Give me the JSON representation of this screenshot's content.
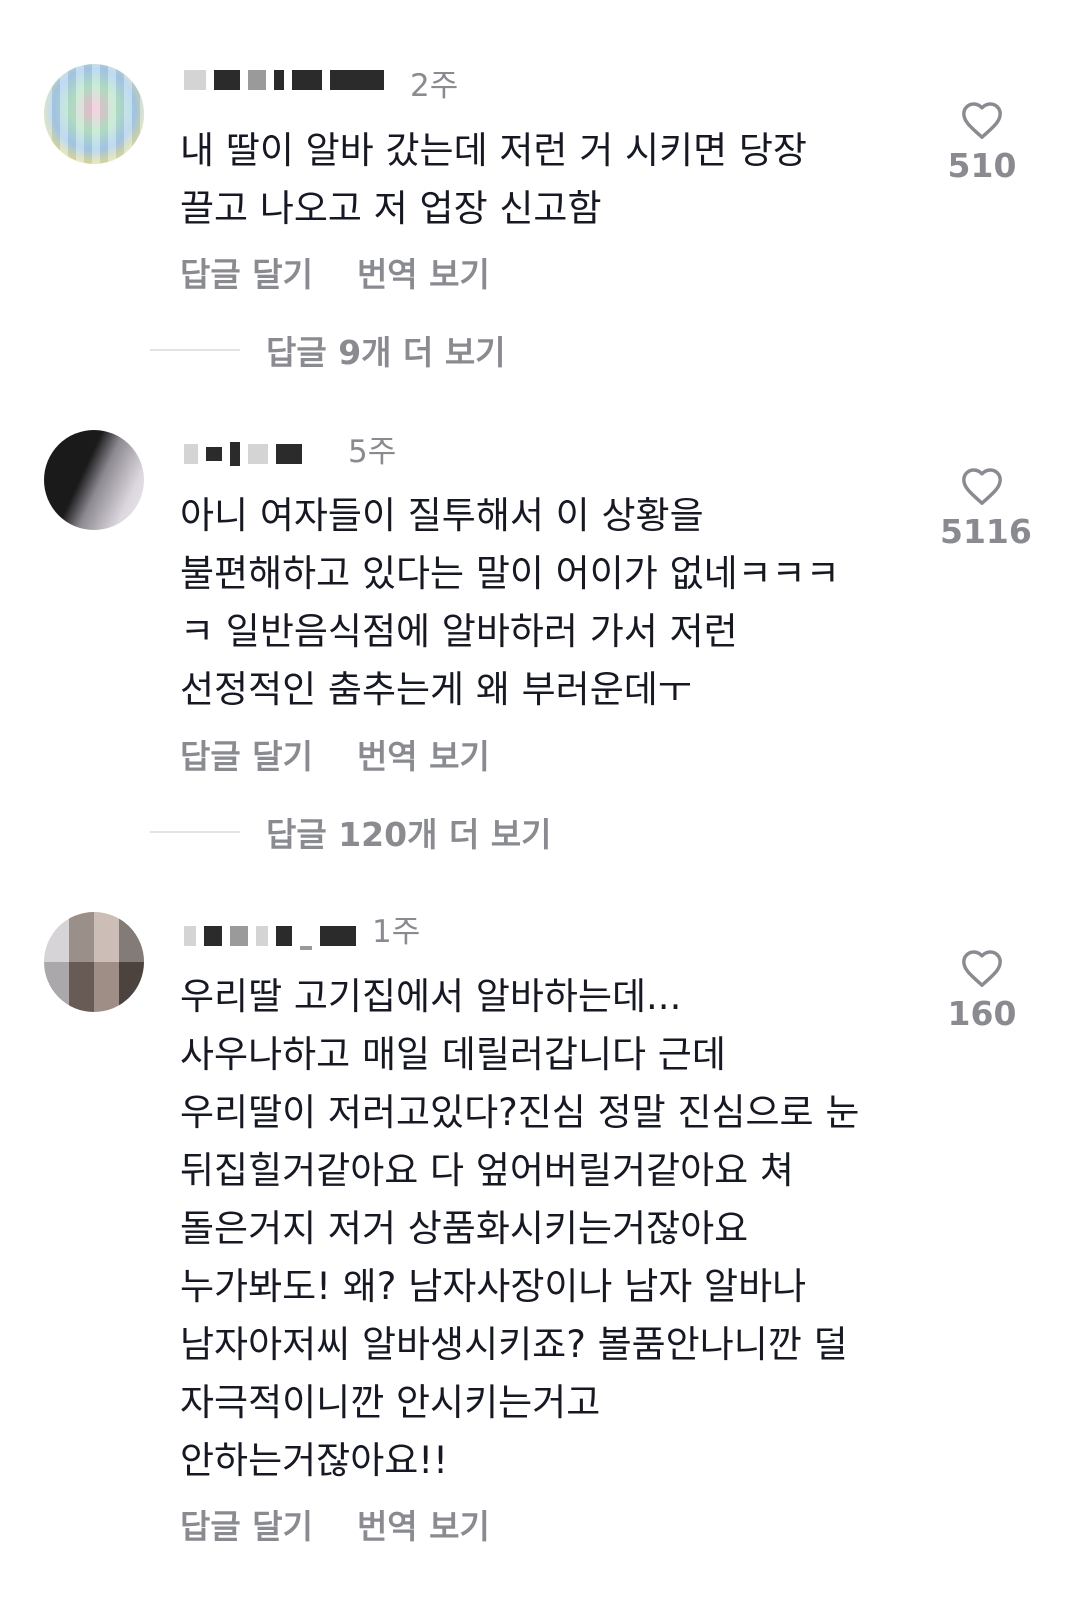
{
  "comments": [
    {
      "time": "2주",
      "lines": [
        "내 딸이 알바 갔는데 저런 거 시키면 당장",
        "끌고 나오고 저 업장 신고함"
      ],
      "reply_label": "답글 달기",
      "translate_label": "번역 보기",
      "likes": "510",
      "more_replies": "답글 9개 더 보기"
    },
    {
      "time": "5주",
      "lines": [
        "아니 여자들이 질투해서 이 상황을",
        "불편해하고 있다는 말이 어이가 없네ㅋㅋㅋ",
        "ㅋ 일반음식점에 알바하러 가서 저런",
        "선정적인 춤추는게 왜 부러운데ㅜ"
      ],
      "reply_label": "답글 달기",
      "translate_label": "번역 보기",
      "likes": "5116",
      "more_replies": "답글 120개 더 보기"
    },
    {
      "time": "1주",
      "lines": [
        "우리딸 고기집에서 알바하는데...",
        "사우나하고 매일 데릴러갑니다 근데",
        "우리딸이 저러고있다?진심 정말 진심으로 눈",
        "뒤집힐거같아요 다 엎어버릴거같아요 쳐",
        "돌은거지 저거 상품화시키는거잖아요",
        "누가봐도! 왜? 남자사장이나 남자 알바나",
        "남자아저씨 알바생시키죠? 볼품안나니깐 덜",
        "자극적이니깐 안시키는거고",
        "안하는거잖아요!!"
      ],
      "reply_label": "답글 달기",
      "translate_label": "번역 보기",
      "likes": "160"
    }
  ],
  "icons": {
    "like": "heart-outline-icon"
  },
  "colors": {
    "text": "#161823",
    "secondary": "#8a8b91",
    "divider": "#e3e3e4"
  }
}
